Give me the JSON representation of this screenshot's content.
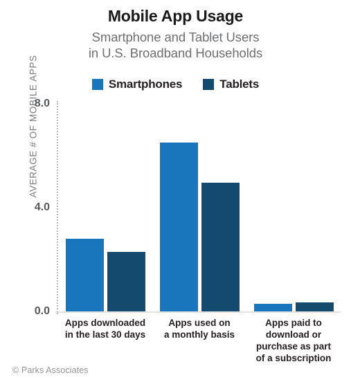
{
  "chart_data": {
    "type": "bar",
    "title": "Mobile App Usage",
    "subtitle_lines": [
      "Smartphone and Tablet Users",
      "in U.S. Broadband Households"
    ],
    "xlabel": "",
    "ylabel": "AVERAGE # OF MOBILE APPS",
    "ylim": [
      0,
      8
    ],
    "yticks": [
      "0.0",
      "4.0",
      "8.0"
    ],
    "ytick_values": [
      0,
      4,
      8
    ],
    "grid": false,
    "legend_position": "top-center",
    "categories": [
      "Apps downloaded in the last 30 days",
      "Apps used on a monthly basis",
      "Apps paid to download or purchase as part of a subscription"
    ],
    "category_label_lines": [
      [
        "Apps downloaded",
        "in the last 30 days"
      ],
      [
        "Apps used on",
        "a monthly basis"
      ],
      [
        "Apps paid to",
        "download or",
        "purchase as part",
        "of a subscription"
      ]
    ],
    "series": [
      {
        "name": "Smartphones",
        "color": "#1a76bc",
        "values": [
          2.8,
          6.5,
          0.3
        ]
      },
      {
        "name": "Tablets",
        "color": "#134a6e",
        "values": [
          2.3,
          4.95,
          0.35
        ]
      }
    ],
    "source_credit": "© Parks Associates"
  },
  "legend": {
    "items": [
      {
        "label": "Smartphones",
        "color": "#1a76bc"
      },
      {
        "label": "Tablets",
        "color": "#134a6e"
      }
    ]
  }
}
